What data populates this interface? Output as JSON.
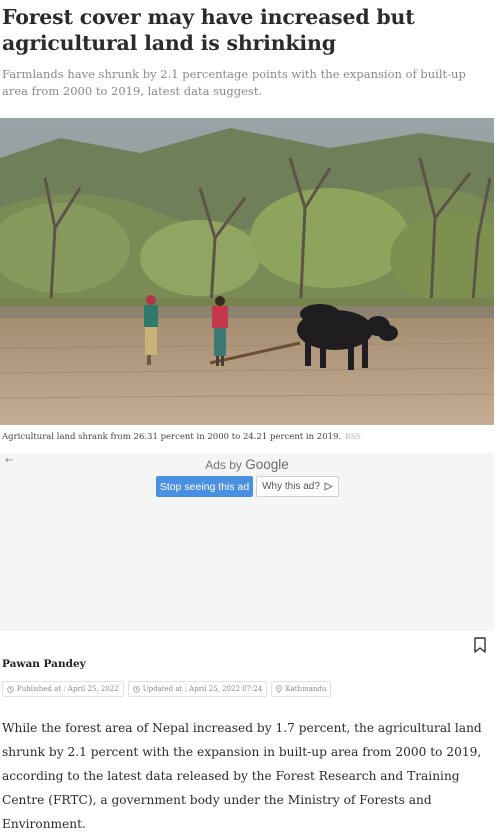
{
  "article": {
    "headline": "Forest cover may have increased but agricultural land is shrinking",
    "subhead": "Farmlands have shrunk by 2.1 percentage points with the expansion of built-up area from 2000 to 2019, latest data suggest.",
    "image_caption": "Agricultural land shrank from 26.31 percent in 2000 to 24.21 percent in 2019.",
    "image_credit": "RSS",
    "author": "Pawan Pandey",
    "published": "Published at : April 25, 2022",
    "updated": "Updated at : April 25, 2022 07:24",
    "location": "Kathmandu",
    "body": "While the forest area of Nepal increased by 1.7 percent, the agricultural land shrunk by 2.1 percent with the expansion in built-up area from 2000 to 2019, according to the latest data released by the Forest Research and Training Centre (FRTC), a government body under the Ministry of Forests and Environment."
  },
  "ad": {
    "ads_by": "Ads by",
    "google": "Google",
    "back_arrow": "←",
    "stop_label": "Stop seeing this ad",
    "why_label": "Why this ad?"
  },
  "icons": {
    "bookmark": "bookmark-icon",
    "clock": "clock-icon",
    "location": "location-pin-icon",
    "info": "ad-choices-icon"
  },
  "colors": {
    "ad_button": "#4a90e2",
    "headline": "#2b2b2b",
    "subhead": "#8a8a8a"
  }
}
